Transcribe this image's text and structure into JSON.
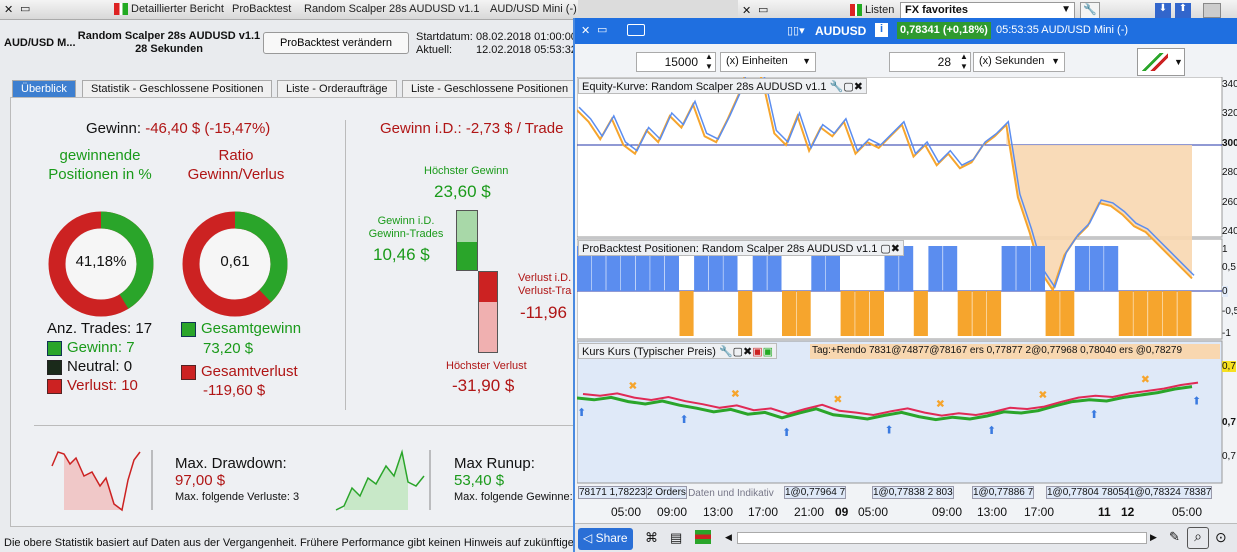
{
  "left_window": {
    "titlebar": {
      "detail_report": "Detaillierter Bericht",
      "probacktest": "ProBacktest",
      "strategy": "Random Scalper 28s AUDUSD v1.1",
      "instrument": "AUD/USD Mini (-)"
    },
    "header": {
      "instrument_short": "AUD/USD M...",
      "title_line1": "Random Scalper 28s AUDUSD v1.1",
      "title_line2": "28 Sekunden",
      "modify_button": "ProBacktest verändern",
      "start_label": "Startdatum:",
      "start_value": "08.02.2018 01:00:00",
      "current_label": "Aktuell:",
      "current_value": "12.02.2018 05:53:32"
    },
    "tabs": [
      "Überblick",
      "Statistik - Geschlossene Positionen",
      "Liste - Orderaufträge",
      "Liste - Geschlossene Positionen"
    ],
    "gain_label": "Gewinn:",
    "gain_value": "-46,40 $ (-15,47%)",
    "winning_label": "gewinnende Positionen in %",
    "winning_value": "41,18%",
    "winning_fraction": 0.4118,
    "ratio_label": "Ratio Gewinn/Verlus",
    "ratio_value": "0,61",
    "ratio_fraction": 0.379,
    "trades_label": "Anz. Trades: 17",
    "win_count": "Gewinn: 7",
    "neutral_count": "Neutral: 0",
    "loss_count": "Verlust: 10",
    "total_gain_label": "Gesamtgewinn",
    "total_gain_value": "73,20 $",
    "total_loss_label": "Gesamtverlust",
    "total_loss_value": "-119,60 $",
    "intraday_label": "Gewinn i.D.: -2,73 $ / Trade",
    "highest_gain_label": "Höchster Gewinn",
    "highest_gain_value": "23,60 $",
    "id_gain_label1": "Gewinn i.D.",
    "id_gain_label2": "Gewinn-Trades",
    "id_gain_value": "10,46 $",
    "id_loss_label1": "Verlust i.D.",
    "id_loss_label2": "Verlust-Tra",
    "id_loss_value": "-11,96",
    "highest_loss_label": "Höchster Verlust",
    "highest_loss_value": "-31,90 $",
    "drawdown_label": "Max. Drawdown:",
    "drawdown_value": "97,00 $",
    "drawdown_sub": "Max. folgende Verluste: 3",
    "runup_label": "Max Runup:",
    "runup_value": "53,40 $",
    "runup_sub": "Max. folgende Gewinne:",
    "footer": "Die obere Statistik basiert auf Daten aus der Vergangenheit. Frühere Performance gibt keinen Hinweis auf zukünftige"
  },
  "top_right": {
    "lists": "Listen",
    "favorites": "FX favorites"
  },
  "chart_window": {
    "symbol": "AUDUSD",
    "price": "0,78341 (+0,18%)",
    "time": "05:53:35 AUD/USD Mini (-)",
    "units_value": "15000",
    "units_label": "(x) Einheiten",
    "seconds_value": "28",
    "seconds_label": "(x) Sekunden",
    "equity_header": "Equity-Kurve: Random Scalper 28s AUDUSD v1.1",
    "positions_header": "ProBacktest Positionen: Random Scalper 28s AUDUSD v1.1",
    "price_header": "Kurs Kurs (Typischer Preis)",
    "tags_text": "Tag:+Rendo 7831@74877@78167 ers 0,77877 2@0,77968 0,78040 ers @0,78279",
    "equity_axis": [
      "340",
      "320",
      "300",
      "280",
      "260",
      "240"
    ],
    "pos_axis": [
      "1",
      "0,5",
      "0",
      "-0,5",
      "-1"
    ],
    "price_axis": [
      "0,7",
      "0,7",
      "0,7"
    ],
    "order_labels": [
      "78171 1,78223",
      "2 Orders",
      "1@0,77964 7",
      "1@0,77838 2 803",
      "1@0,77886 7",
      "1@0,77804 78054",
      "1@0,78324 78387"
    ],
    "watermark": "©2017 IT-Finance.com Daten und Indikativ",
    "time_axis": [
      "05:00",
      "09:00",
      "13:00",
      "17:00",
      "21:00",
      "09",
      "05:00",
      "09:00",
      "13:00",
      "17:00",
      "11",
      "12",
      "05:00"
    ],
    "share": "Share"
  },
  "chart_data": {
    "type": "line",
    "equity": [
      312,
      308,
      302,
      309,
      300,
      297,
      305,
      301,
      310,
      306,
      314,
      303,
      301,
      309,
      318,
      331,
      322,
      304,
      300,
      310,
      298,
      306,
      303,
      308,
      297,
      301,
      299,
      303,
      307,
      296,
      300,
      293,
      297,
      292,
      294,
      300,
      303,
      307,
      282,
      270,
      256,
      250,
      262,
      268,
      272,
      280,
      279,
      276,
      272,
      270,
      266,
      262,
      258,
      254
    ],
    "positions": [
      1,
      1,
      1,
      1,
      1,
      1,
      1,
      -1,
      1,
      1,
      1,
      -1,
      1,
      1,
      -1,
      -1,
      1,
      1,
      -1,
      -1,
      -1,
      1,
      1,
      -1,
      1,
      1,
      -1,
      -1,
      -1,
      1,
      1,
      1,
      -1,
      -1,
      1,
      1,
      1,
      -1,
      -1,
      -1,
      -1,
      -1
    ],
    "price": [
      0.7815,
      0.7812,
      0.7816,
      0.7809,
      0.7805,
      0.781,
      0.7803,
      0.7798,
      0.7792,
      0.7796,
      0.7788,
      0.7791,
      0.7782,
      0.779,
      0.7797,
      0.7787,
      0.7784,
      0.778,
      0.7786,
      0.7791,
      0.7784,
      0.7779,
      0.7783,
      0.778,
      0.7785,
      0.7792,
      0.779,
      0.7794,
      0.7802,
      0.7809,
      0.7812,
      0.781,
      0.7816,
      0.782,
      0.7824,
      0.783,
      0.7834
    ]
  }
}
